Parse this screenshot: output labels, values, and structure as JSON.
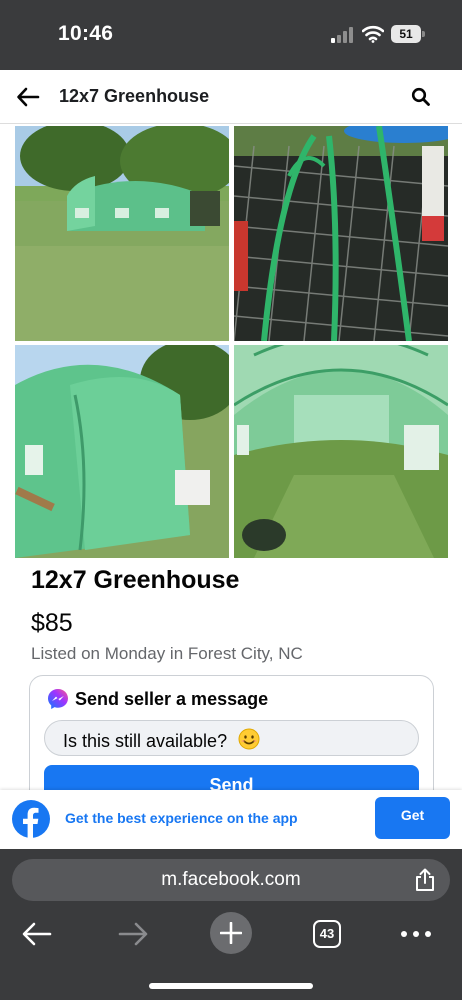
{
  "status_bar": {
    "time": "10:46",
    "battery": "51"
  },
  "header": {
    "title": "12x7 Greenhouse"
  },
  "photos": [
    {
      "alt": "Greenhouse in a field"
    },
    {
      "alt": "Green frame poles on a mesh table"
    },
    {
      "alt": "Greenhouse side view"
    },
    {
      "alt": "Greenhouse interior"
    }
  ],
  "listing": {
    "title": "12x7 Greenhouse",
    "price": "$85",
    "meta": "Listed on Monday in Forest City, NC"
  },
  "message_card": {
    "title": "Send seller a message",
    "input_value": "Is this still available?",
    "emoji": "😊",
    "send_label": "Send"
  },
  "app_banner": {
    "text": "Get the best experience on the app",
    "button_label": "Get"
  },
  "browser": {
    "url": "m.facebook.com",
    "tab_count": "43"
  },
  "colors": {
    "brand_blue": "#1877f2",
    "chrome_dark": "#3a3b3d"
  },
  "icons": [
    "signal-icon",
    "wifi-icon",
    "back-arrow-icon",
    "search-icon",
    "messenger-icon",
    "facebook-logo-icon",
    "share-icon",
    "nav-back-icon",
    "nav-forward-icon",
    "plus-icon",
    "more-icon"
  ]
}
